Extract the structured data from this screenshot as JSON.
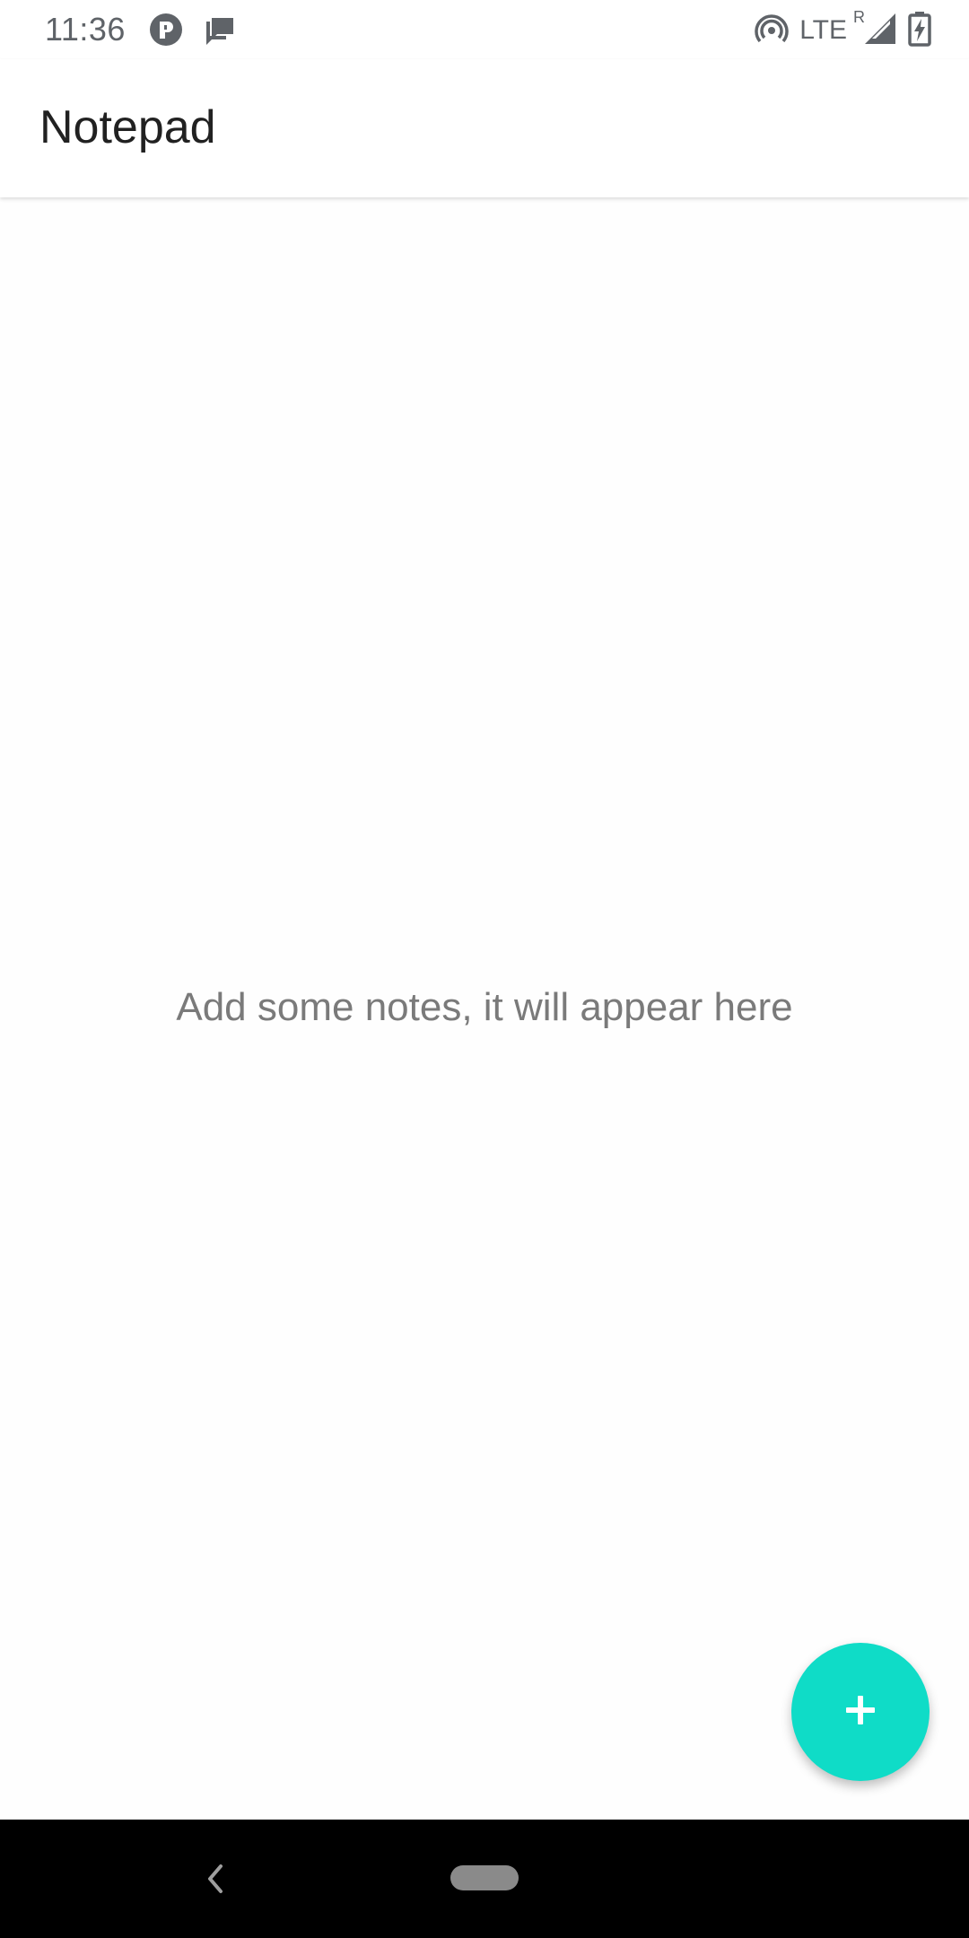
{
  "status_bar": {
    "time": "11:36",
    "left_icons": [
      "app-notification-icon",
      "chat-icon"
    ],
    "right_icons": [
      "hotspot-icon",
      "signal-icon",
      "battery-charging-icon"
    ],
    "network": "LTE",
    "roaming": "R"
  },
  "app_bar": {
    "title": "Notepad"
  },
  "main": {
    "empty_message": "Add some notes, it will appear here"
  },
  "fab": {
    "icon": "plus-icon",
    "color": "#0fdcc7"
  },
  "nav_bar": {
    "icons": [
      "back-icon",
      "home-pill"
    ]
  }
}
